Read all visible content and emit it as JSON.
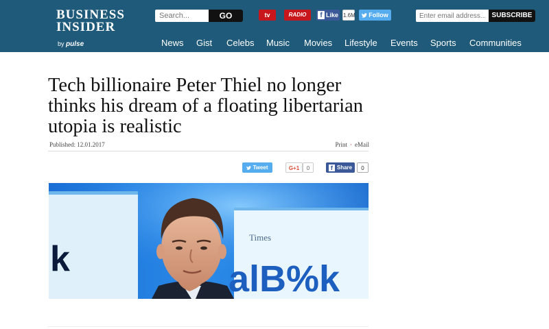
{
  "header": {
    "logo": {
      "line1": "BUSINESS",
      "line2": "INSIDER",
      "by": "by",
      "brand": "pulse"
    },
    "search": {
      "placeholder": "Search...",
      "button": "GO"
    },
    "social": {
      "tv": "tv",
      "radio": "RADIO",
      "facebook_like": "Like",
      "facebook_count": "1.6M",
      "twitter_follow": "Follow"
    },
    "newsletter": {
      "placeholder": "Enter email address...",
      "button": "SUBSCRIBE"
    },
    "nav": [
      "News",
      "Gist",
      "Celebs",
      "Music",
      "Movies",
      "Lifestyle",
      "Events",
      "Sports",
      "Communities"
    ]
  },
  "article": {
    "title": "Tech billionaire Peter Thiel no longer thinks his dream of a floating libertarian utopia is realistic",
    "published": "Published: 12.01.2017",
    "print": "Print",
    "email": "eMail",
    "share": {
      "tweet": "Tweet",
      "gplus": "G+1",
      "gplus_count": "0",
      "fb_share": "Share",
      "fb_count": "0"
    },
    "photo": {
      "screen_text": "alB%k",
      "screen_small": "Times",
      "screen_left": "k"
    }
  },
  "colors": {
    "header_bg": "#1f5a7a",
    "tv_red": "#c8161d",
    "facebook": "#3b5998",
    "twitter": "#55acee",
    "google_red": "#dd4b39"
  }
}
